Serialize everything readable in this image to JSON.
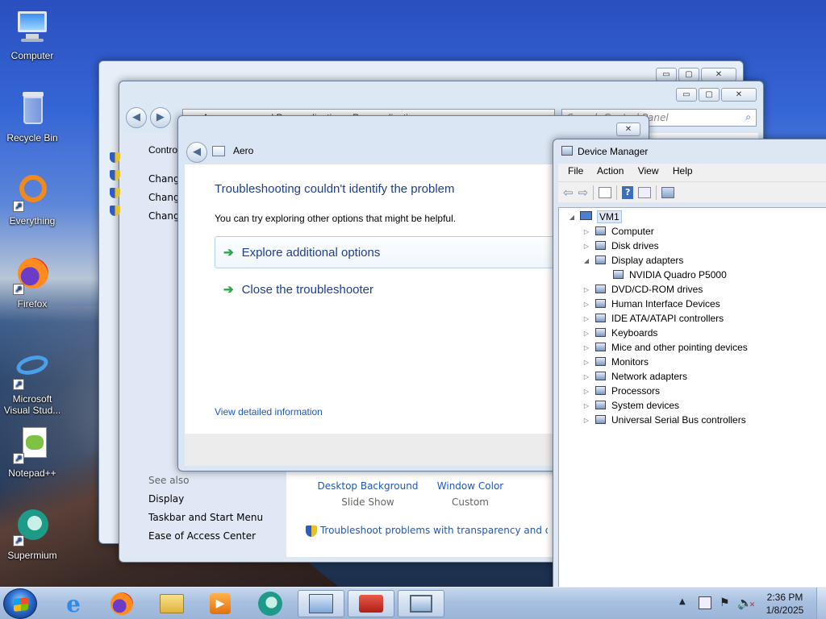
{
  "desktop": {
    "icons": [
      {
        "label": "Computer"
      },
      {
        "label": "Recycle Bin"
      },
      {
        "label": "Everything"
      },
      {
        "label": "Firefox"
      },
      {
        "label": "Microsoft Visual Stud..."
      },
      {
        "label": "Notepad++"
      },
      {
        "label": "Supermium"
      }
    ]
  },
  "control_panel_back": {
    "buttons": {
      "min": "▭",
      "max": "▢",
      "close": "✕"
    }
  },
  "control_panel": {
    "address": "Appearance and Personalization ▸ Personalization",
    "search_placeholder": "Search Control Panel",
    "sidebar_items": [
      "Contro",
      "Chang",
      "Chang",
      "Chang"
    ],
    "see_also_heading": "See also",
    "see_also": [
      "Display",
      "Taskbar and Start Menu",
      "Ease of Access Center"
    ],
    "bottom_items": [
      {
        "label": "Desktop Background",
        "sub": "Slide Show"
      },
      {
        "label": "Window Color",
        "sub": "Custom"
      }
    ],
    "troubleshoot_link": "Troubleshoot problems with transparency and other Aero effects"
  },
  "aero_dialog": {
    "title": "Aero",
    "heading": "Troubleshooting couldn't identify the problem",
    "subtext": "You can try exploring other options that might be helpful.",
    "options": [
      "Explore additional options",
      "Close the troubleshooter"
    ],
    "detail_link": "View detailed information"
  },
  "device_manager": {
    "title": "Device Manager",
    "menu": [
      "File",
      "Action",
      "View",
      "Help"
    ],
    "root": "VM1",
    "nodes": [
      {
        "label": "Computer",
        "expanded": false
      },
      {
        "label": "Disk drives",
        "expanded": false
      },
      {
        "label": "Display adapters",
        "expanded": true
      },
      {
        "label": "NVIDIA Quadro P5000",
        "child": true
      },
      {
        "label": "DVD/CD-ROM drives",
        "expanded": false
      },
      {
        "label": "Human Interface Devices",
        "expanded": false
      },
      {
        "label": "IDE ATA/ATAPI controllers",
        "expanded": false
      },
      {
        "label": "Keyboards",
        "expanded": false
      },
      {
        "label": "Mice and other pointing devices",
        "expanded": false
      },
      {
        "label": "Monitors",
        "expanded": false
      },
      {
        "label": "Network adapters",
        "expanded": false
      },
      {
        "label": "Processors",
        "expanded": false
      },
      {
        "label": "System devices",
        "expanded": false
      },
      {
        "label": "Universal Serial Bus controllers",
        "expanded": false
      }
    ]
  },
  "taskbar": {
    "time": "2:36 PM",
    "date": "1/8/2025"
  },
  "colors": {
    "link": "#1e58b6",
    "heading": "#1e3f8a",
    "arrow": "#2aa64a"
  }
}
